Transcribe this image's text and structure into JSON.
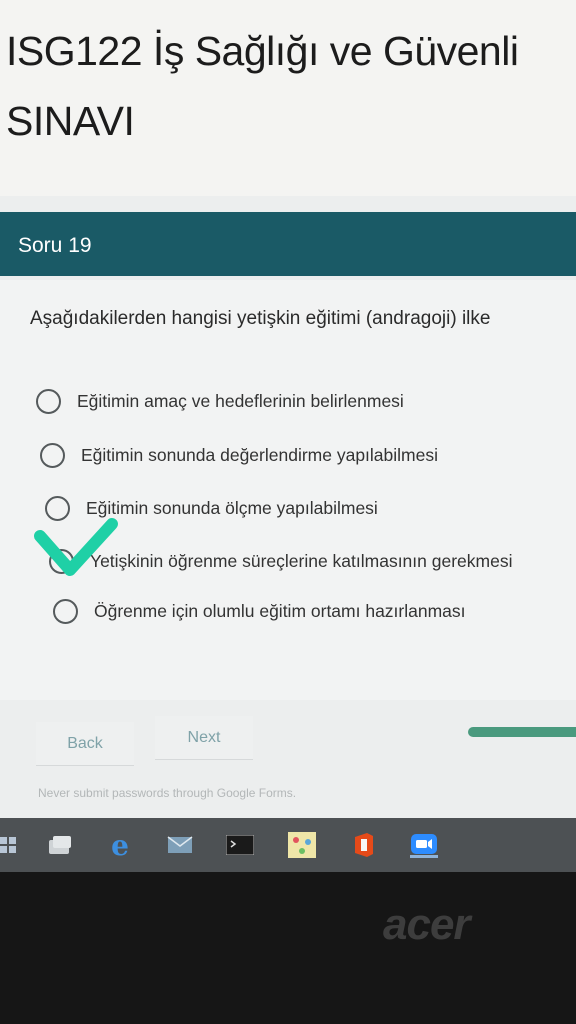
{
  "form": {
    "title_line1": "ISG122 İş Sağlığı ve Güvenli",
    "title_line2": "SINAVI"
  },
  "section": {
    "label": "Soru 19"
  },
  "question": {
    "text": "Aşağıdakilerden hangisi yetişkin eğitimi (andragoji) ilke",
    "options": [
      "Eğitimin amaç ve hedeflerinin belirlenmesi",
      "Eğitimin sonunda değerlendirme yapılabilmesi",
      "Eğitimin sonunda ölçme yapılabilmesi",
      "Yetişkinin öğrenme süreçlerine katılmasının gerekmesi",
      "Öğrenme için olumlu eğitim ortamı hazırlanması"
    ],
    "selected_mark": "check-icon",
    "marked_option": 4
  },
  "nav": {
    "back_label": "Back",
    "next_label": "Next"
  },
  "footer": {
    "note": "Never submit passwords through Google Forms."
  },
  "taskbar": {
    "icons": [
      "windows-icon",
      "task-view-icon",
      "edge-icon",
      "mail-icon",
      "terminal-icon",
      "app-tile-icon",
      "office-icon",
      "zoom-icon"
    ]
  },
  "device": {
    "brand": "acer"
  },
  "colors": {
    "section_bar": "#1a5a66",
    "check_mark": "#1fd0a6",
    "button_text": "#7fa2a8",
    "progress": "#4a9a7e",
    "taskbar": "#4d5154"
  }
}
